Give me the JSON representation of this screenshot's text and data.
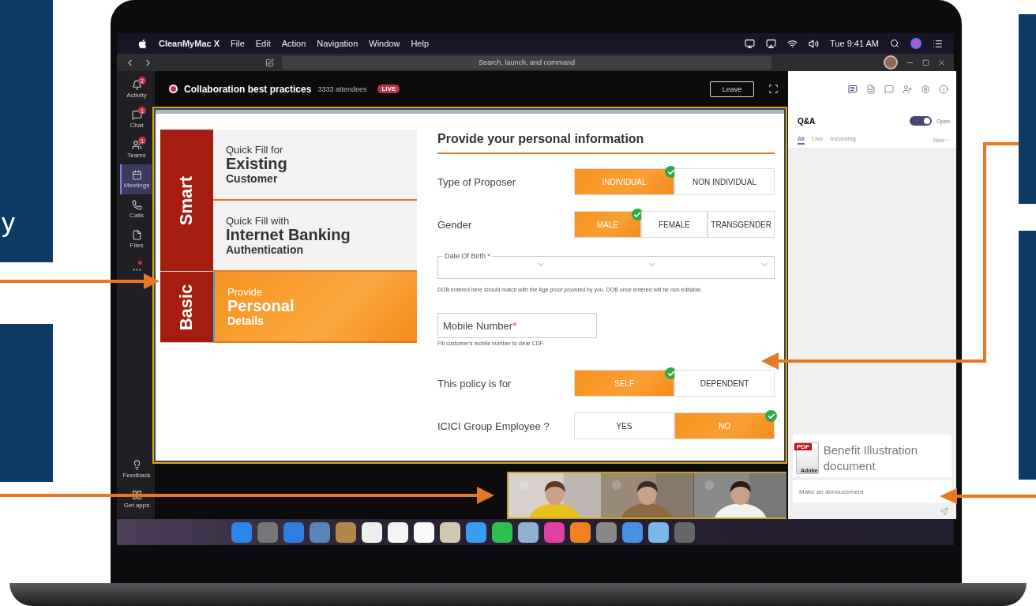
{
  "callouts": [
    {
      "text": "y"
    }
  ],
  "menubar": {
    "app": "CleanMyMac X",
    "menus": [
      "File",
      "Edit",
      "Action",
      "Navigation",
      "Window",
      "Help"
    ],
    "clock": "Tue 9:41 AM"
  },
  "titlebar": {
    "search_placeholder": "Search, launch, and command"
  },
  "rail": {
    "items": [
      {
        "label": "Activity",
        "badge": "2",
        "selected": false
      },
      {
        "label": "Chat",
        "badge": "1",
        "selected": false
      },
      {
        "label": "Teams",
        "badge": "1",
        "selected": false
      },
      {
        "label": "Meetings",
        "selected": true
      },
      {
        "label": "Calls",
        "selected": false
      },
      {
        "label": "Files",
        "selected": false
      },
      {
        "dot": true,
        "selected": false
      }
    ],
    "bottom": [
      {
        "label": "Feedback"
      },
      {
        "label": "Get apps"
      }
    ]
  },
  "meeting": {
    "title": "Collaboration best practices",
    "attendees": "3333 attendees",
    "live": "LIVE",
    "leave": "Leave"
  },
  "slide": {
    "groups": [
      {
        "label": "Smart",
        "options": [
          {
            "prefix": "Quick Fill for",
            "main": "Existing",
            "suffix": "Customer",
            "selected": false
          },
          {
            "prefix": "Quick Fill with",
            "main": "Internet Banking",
            "suffix": "Authentication",
            "selected": false
          }
        ]
      },
      {
        "label": "Basic",
        "options": [
          {
            "prefix": "Provide",
            "main": "Personal",
            "suffix": "Details",
            "selected": true
          }
        ]
      }
    ],
    "heading": "Provide your personal information",
    "fields": [
      {
        "kind": "toggle",
        "label": "Type of Proposer",
        "options": [
          {
            "label": "INDIVIDUAL",
            "selected": true
          },
          {
            "label": "NON INDIVIDUAL",
            "selected": false
          }
        ]
      },
      {
        "kind": "toggle",
        "label": "Gender",
        "options": [
          {
            "label": "MALE",
            "selected": true
          },
          {
            "label": "FEMALE",
            "selected": false
          },
          {
            "label": "TRANSGENDER",
            "selected": false
          }
        ]
      },
      {
        "kind": "date",
        "label": "Date Of Birth",
        "required_mark": "*",
        "note": "DOB entered here should match with the Age proof provided by you. DOB once entered will be non editable."
      },
      {
        "kind": "text",
        "placeholder": "Mobile Number",
        "required_mark": "*",
        "note": "Fill customer's mobile number to clear CDF."
      },
      {
        "kind": "toggle",
        "label": "This policy is for",
        "options": [
          {
            "label": "SELF",
            "selected": true
          },
          {
            "label": "DEPENDENT",
            "selected": false
          }
        ]
      },
      {
        "kind": "toggle",
        "label": "ICICI Group Employee ?",
        "options": [
          {
            "label": "YES",
            "selected": false
          },
          {
            "label": "NO",
            "selected": true
          }
        ]
      }
    ]
  },
  "panel": {
    "title": "Q&A",
    "open": true,
    "open_label": "Open",
    "tabs": [
      {
        "label": "All",
        "selected": true
      },
      {
        "label": "Live",
        "selected": false
      },
      {
        "label": "Incoming",
        "selected": false
      }
    ],
    "sort": "New",
    "attachment": {
      "badge": "PDF",
      "brand": "Adobe",
      "name": "Benefit Illustration document"
    },
    "announce_placeholder": "Make an annoucement"
  }
}
